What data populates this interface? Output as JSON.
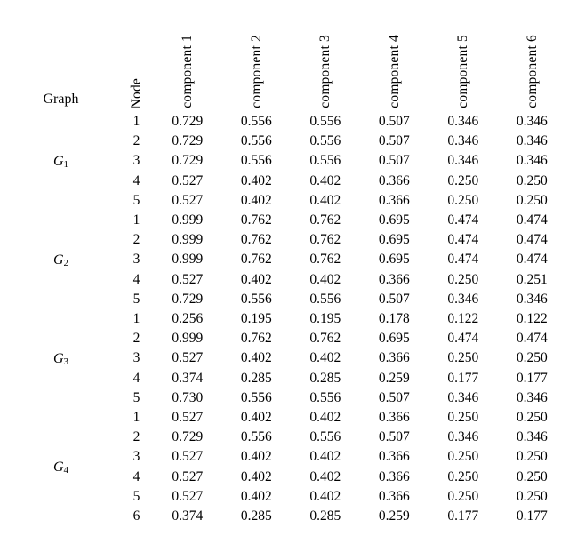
{
  "table": {
    "headers": {
      "graph": "Graph",
      "node": "Node",
      "components": [
        "component 1",
        "component 2",
        "component 3",
        "component 4",
        "component 5",
        "component 6"
      ]
    },
    "blocks": [
      {
        "graph": "G",
        "graph_sub": "1",
        "rows": [
          {
            "node": "1",
            "values": [
              "0.729",
              "0.556",
              "0.556",
              "0.507",
              "0.346",
              "0.346"
            ]
          },
          {
            "node": "2",
            "values": [
              "0.729",
              "0.556",
              "0.556",
              "0.507",
              "0.346",
              "0.346"
            ]
          },
          {
            "node": "3",
            "values": [
              "0.729",
              "0.556",
              "0.556",
              "0.507",
              "0.346",
              "0.346"
            ]
          },
          {
            "node": "4",
            "values": [
              "0.527",
              "0.402",
              "0.402",
              "0.366",
              "0.250",
              "0.250"
            ]
          },
          {
            "node": "5",
            "values": [
              "0.527",
              "0.402",
              "0.402",
              "0.366",
              "0.250",
              "0.250"
            ]
          }
        ]
      },
      {
        "graph": "G",
        "graph_sub": "2",
        "rows": [
          {
            "node": "1",
            "values": [
              "0.999",
              "0.762",
              "0.762",
              "0.695",
              "0.474",
              "0.474"
            ]
          },
          {
            "node": "2",
            "values": [
              "0.999",
              "0.762",
              "0.762",
              "0.695",
              "0.474",
              "0.474"
            ]
          },
          {
            "node": "3",
            "values": [
              "0.999",
              "0.762",
              "0.762",
              "0.695",
              "0.474",
              "0.474"
            ]
          },
          {
            "node": "4",
            "values": [
              "0.527",
              "0.402",
              "0.402",
              "0.366",
              "0.250",
              "0.251"
            ]
          },
          {
            "node": "5",
            "values": [
              "0.729",
              "0.556",
              "0.556",
              "0.507",
              "0.346",
              "0.346"
            ]
          }
        ]
      },
      {
        "graph": "G",
        "graph_sub": "3",
        "rows": [
          {
            "node": "1",
            "values": [
              "0.256",
              "0.195",
              "0.195",
              "0.178",
              "0.122",
              "0.122"
            ]
          },
          {
            "node": "2",
            "values": [
              "0.999",
              "0.762",
              "0.762",
              "0.695",
              "0.474",
              "0.474"
            ]
          },
          {
            "node": "3",
            "values": [
              "0.527",
              "0.402",
              "0.402",
              "0.366",
              "0.250",
              "0.250"
            ]
          },
          {
            "node": "4",
            "values": [
              "0.374",
              "0.285",
              "0.285",
              "0.259",
              "0.177",
              "0.177"
            ]
          },
          {
            "node": "5",
            "values": [
              "0.730",
              "0.556",
              "0.556",
              "0.507",
              "0.346",
              "0.346"
            ]
          }
        ]
      },
      {
        "graph": "G",
        "graph_sub": "4",
        "rows": [
          {
            "node": "1",
            "values": [
              "0.527",
              "0.402",
              "0.402",
              "0.366",
              "0.250",
              "0.250"
            ]
          },
          {
            "node": "2",
            "values": [
              "0.729",
              "0.556",
              "0.556",
              "0.507",
              "0.346",
              "0.346"
            ]
          },
          {
            "node": "3",
            "values": [
              "0.527",
              "0.402",
              "0.402",
              "0.366",
              "0.250",
              "0.250"
            ]
          },
          {
            "node": "4",
            "values": [
              "0.527",
              "0.402",
              "0.402",
              "0.366",
              "0.250",
              "0.250"
            ]
          },
          {
            "node": "5",
            "values": [
              "0.527",
              "0.402",
              "0.402",
              "0.366",
              "0.250",
              "0.250"
            ]
          },
          {
            "node": "6",
            "values": [
              "0.374",
              "0.285",
              "0.285",
              "0.259",
              "0.177",
              "0.177"
            ]
          }
        ]
      }
    ]
  },
  "chart_data": {
    "type": "table",
    "title": "",
    "columns": [
      "Graph",
      "Node",
      "component 1",
      "component 2",
      "component 3",
      "component 4",
      "component 5",
      "component 6"
    ],
    "rows": [
      [
        "G1",
        "1",
        0.729,
        0.556,
        0.556,
        0.507,
        0.346,
        0.346
      ],
      [
        "G1",
        "2",
        0.729,
        0.556,
        0.556,
        0.507,
        0.346,
        0.346
      ],
      [
        "G1",
        "3",
        0.729,
        0.556,
        0.556,
        0.507,
        0.346,
        0.346
      ],
      [
        "G1",
        "4",
        0.527,
        0.402,
        0.402,
        0.366,
        0.25,
        0.25
      ],
      [
        "G1",
        "5",
        0.527,
        0.402,
        0.402,
        0.366,
        0.25,
        0.25
      ],
      [
        "G2",
        "1",
        0.999,
        0.762,
        0.762,
        0.695,
        0.474,
        0.474
      ],
      [
        "G2",
        "2",
        0.999,
        0.762,
        0.762,
        0.695,
        0.474,
        0.474
      ],
      [
        "G2",
        "3",
        0.999,
        0.762,
        0.762,
        0.695,
        0.474,
        0.474
      ],
      [
        "G2",
        "4",
        0.527,
        0.402,
        0.402,
        0.366,
        0.25,
        0.251
      ],
      [
        "G2",
        "5",
        0.729,
        0.556,
        0.556,
        0.507,
        0.346,
        0.346
      ],
      [
        "G3",
        "1",
        0.256,
        0.195,
        0.195,
        0.178,
        0.122,
        0.122
      ],
      [
        "G3",
        "2",
        0.999,
        0.762,
        0.762,
        0.695,
        0.474,
        0.474
      ],
      [
        "G3",
        "3",
        0.527,
        0.402,
        0.402,
        0.366,
        0.25,
        0.25
      ],
      [
        "G3",
        "4",
        0.374,
        0.285,
        0.285,
        0.259,
        0.177,
        0.177
      ],
      [
        "G3",
        "5",
        0.73,
        0.556,
        0.556,
        0.507,
        0.346,
        0.346
      ],
      [
        "G4",
        "1",
        0.527,
        0.402,
        0.402,
        0.366,
        0.25,
        0.25
      ],
      [
        "G4",
        "2",
        0.729,
        0.556,
        0.556,
        0.507,
        0.346,
        0.346
      ],
      [
        "G4",
        "3",
        0.527,
        0.402,
        0.402,
        0.366,
        0.25,
        0.25
      ],
      [
        "G4",
        "4",
        0.527,
        0.402,
        0.402,
        0.366,
        0.25,
        0.25
      ],
      [
        "G4",
        "5",
        0.527,
        0.402,
        0.402,
        0.366,
        0.25,
        0.25
      ],
      [
        "G4",
        "6",
        0.374,
        0.285,
        0.285,
        0.259,
        0.177,
        0.177
      ]
    ]
  }
}
